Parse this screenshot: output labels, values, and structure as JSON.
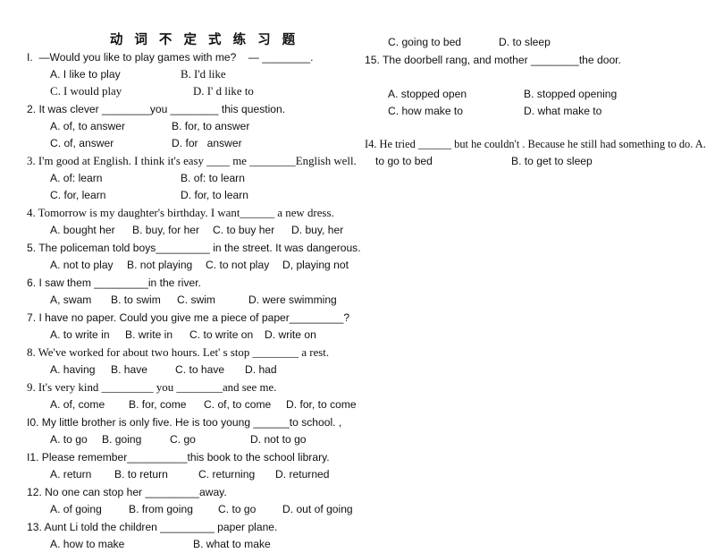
{
  "document": {
    "title": "动 词 不 定 式 练 习 题",
    "title_icon": "none"
  },
  "left_column": {
    "items": [
      {
        "number": "I.",
        "stem_before": "—Would you like to play games with me?    — ",
        "stem_after": ".",
        "stem_full": "I.  —Would you like to play games with me?    — ________.",
        "options_row1": [
          "A. I like to play",
          "B. I'd like"
        ],
        "options_row2": [
          "C. I would play",
          "D. I' d like to"
        ]
      },
      {
        "number": "2.",
        "stem_full": "2. It was clever ________you ________ this question.",
        "options_row1": [
          "A. of, to answer",
          "B. for, to answer"
        ],
        "options_row2": [
          "C. of, answer",
          "D. for   answer"
        ]
      },
      {
        "number": "3.",
        "stem_full": "3. I'm good at English. I think it's easy ____ me ________English well.",
        "options_row1": [
          "A. of: learn",
          "B. of: to learn"
        ],
        "options_row2": [
          "C. for, learn",
          "D. for, to learn"
        ]
      },
      {
        "number": "4.",
        "stem_full": "4. Tomorrow is my daughter's birthday. I want______ a new dress.",
        "options_row1": [
          "A. bought her",
          "B. buy, for her",
          "C. to buy her",
          "D. buy, her"
        ],
        "options_row2": []
      },
      {
        "number": "5.",
        "stem_full": "5. The policeman told boys_________ in the street. It was dangerous.",
        "options_row1": [
          "A. not to play",
          "B. not playing",
          "C. to not play",
          "D, playing not"
        ],
        "options_row2": []
      },
      {
        "number": "6.",
        "stem_full": "6. I saw them _________in the river.",
        "options_row1": [
          "A, swam",
          "B. to swim",
          "C. swim",
          "D. were swimming"
        ],
        "options_row2": []
      },
      {
        "number": "7.",
        "stem_full": "7. I have no paper. Could you give me a piece of paper_________?",
        "options_row1": [
          "A. to write in",
          "B. write in",
          "C. to write on",
          "D. write on"
        ],
        "options_row2": []
      },
      {
        "number": "8.",
        "stem_full": "8. We've worked for about two hours. Let' s stop ________ a rest.",
        "options_row1": [
          "A. having",
          "B. have",
          "C. to have",
          "D. had"
        ],
        "options_row2": []
      },
      {
        "number": "9.",
        "stem_full": "9. It's very kind _________ you ________and see me.",
        "options_row1": [
          "A. of, come",
          "B. for, come",
          "C. of, to come",
          "D. for, to come"
        ],
        "options_row2": []
      },
      {
        "number": "I0.",
        "stem_full": "I0. My little brother is only five. He is too young ______to school. ,",
        "options_row1": [
          "A. to go",
          "B. going",
          "C. go",
          "D. not to go"
        ],
        "options_row2": []
      },
      {
        "number": "I1.",
        "stem_full": "I1. Please remember__________this book to the school library.",
        "options_row1": [
          "A. return",
          "B. to return",
          "C. returning",
          "D. returned"
        ],
        "options_row2": []
      },
      {
        "number": "12.",
        "stem_full": "12. No one can stop her _________away.",
        "options_row1": [
          "A. of going",
          "B. from going",
          "C. to go",
          "D. out of going"
        ],
        "options_row2": []
      },
      {
        "number": "13.",
        "stem_full": "13. Aunt Li told the children _________ paper plane.",
        "options_row1": [
          "A. how to make",
          "B. what to make"
        ],
        "options_row2": []
      }
    ]
  },
  "right_column": {
    "items": [
      {
        "number": "",
        "stem_full": "",
        "options_row1": [
          "C. going to bed",
          "D. to sleep"
        ],
        "options_row2": []
      },
      {
        "number": "15.",
        "stem_full": "15. The doorbell rang, and mother ________the door.",
        "options_row1": [
          "A. stopped open",
          "B. stopped opening"
        ],
        "options_row2": [
          "C. how make to",
          "D. what make to"
        ]
      },
      {
        "number": "I4.",
        "stem_full": "I4. He tried ______ but he couldn't . Because he still had something to do. A.",
        "options_row1": [
          "to go to bed",
          "B. to get to sleep"
        ],
        "options_row2": []
      }
    ]
  }
}
